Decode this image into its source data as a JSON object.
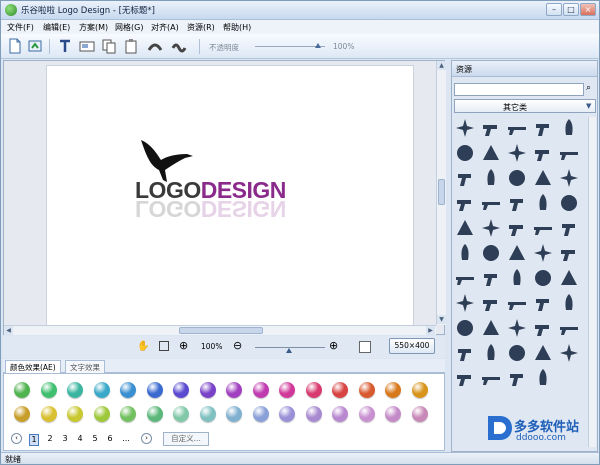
{
  "window": {
    "title": "乐谷啦啦 Logo Design - [无标题*]"
  },
  "window_controls": {
    "minimize": "–",
    "maximize": "□",
    "close": "×"
  },
  "menu": [
    "文件(F)",
    "编辑(E)",
    "方案(M)",
    "网格(G)",
    "对齐(A)",
    "资源(R)",
    "帮助(H)"
  ],
  "toolbar": {
    "opacity_label": "不透明度",
    "opacity_value": "100%",
    "icons": [
      "new-file-icon",
      "open-file-icon",
      "text-tool-icon",
      "image-tool-icon",
      "copy-icon",
      "paste-icon",
      "arc-text-icon",
      "wave-text-icon"
    ]
  },
  "logo": {
    "text_dark": "LOGO",
    "text_color": "DESIGN",
    "dark_color": "#3a3a3a",
    "accent_color": "#8a2a8a"
  },
  "zoom": {
    "value": "100%",
    "size_button": "550×400"
  },
  "tabs": [
    "颜色效果(AE)",
    "文字效果"
  ],
  "swatches_row1": [
    "#4fb34f",
    "#3fbf6f",
    "#3ab5a0",
    "#3aa8c8",
    "#3a8fd0",
    "#3a6ad0",
    "#5a4ad0",
    "#7a42c8",
    "#a040c0",
    "#c03ab0",
    "#d0389a",
    "#d83a70",
    "#d84444",
    "#d85a2f",
    "#d8781c",
    "#d8941a"
  ],
  "swatches_row2": [
    "#c89e2a",
    "#d8c030",
    "#c8c830",
    "#9ec83a",
    "#72c060",
    "#5cb87a",
    "#80c8a8",
    "#80c0c0",
    "#80b0d0",
    "#8aa0d8",
    "#9a90d8",
    "#a88ad0",
    "#b888d0",
    "#c890d0",
    "#c48ac8",
    "#c888b8"
  ],
  "pager": {
    "pages": [
      "1",
      "2",
      "3",
      "4",
      "5",
      "6",
      "..."
    ],
    "custom_label": "自定义..."
  },
  "resources": {
    "header": "资源",
    "search_placeholder": "",
    "category": "其它类",
    "icons": [
      "propeller-icon",
      "pistol-icon",
      "rifle-icon",
      "revolver-icon",
      "rocket-icon",
      "bomb-missile-icon",
      "bullets-icon",
      "bullet-icon",
      "submachine-gun-icon",
      "crosshair-icon",
      "radiation-icon",
      "bomb-icon",
      "grenade-icon",
      "shell-icon",
      "missile-tilt-icon",
      "biohazard-icon",
      "hook-icon",
      "gas-can-icon",
      "radiation-symbol-icon",
      "spray-icon",
      "fighter-jet-1-icon",
      "fighter-jet-2-icon",
      "fighter-jet-3-icon",
      "fighter-jet-4-icon",
      "fighter-jet-5-icon",
      "jet-6-icon",
      "jet-7-icon",
      "jet-8-icon",
      "jet-9-icon",
      "jet-10-icon",
      "jet-11-icon",
      "jet-12-icon",
      "jet-13-icon",
      "tank-icon",
      "ship-icon",
      "plane-top-icon",
      "plane-2-icon",
      "gas-mask-icon",
      "skull-crossbones-icon",
      "crossbones-icon",
      "alien-icon",
      "astronaut-icon",
      "chess-piece-icon",
      "head-icon",
      "wreath-icon",
      "film-reel-icon",
      "film-reel-2-icon",
      "explosion-icon",
      "lightbulb-icon",
      "lightbulb-2-icon",
      "clapperboard-icon",
      "clapperboard-2-icon",
      "trophy-icon",
      "easel-icon"
    ]
  },
  "statusbar": {
    "text": "就绪"
  },
  "watermark": {
    "text": "多多软件站",
    "domain": "ddooo.com"
  }
}
